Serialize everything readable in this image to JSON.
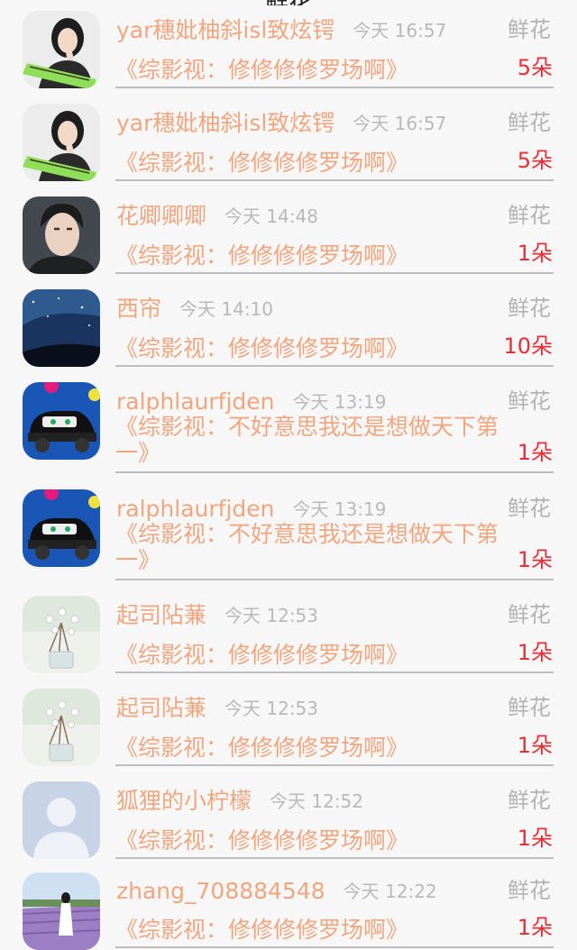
{
  "header": {
    "partial_title": "鲜花"
  },
  "items": [
    {
      "name": "yar穗妣柚斜isl致炫锷",
      "time": "今天 16:57",
      "label": "鲜花",
      "message": "《综影视：修修修修罗场啊》",
      "count": "5朵",
      "avatar": "girl-green-banner"
    },
    {
      "name": "yar穗妣柚斜isl致炫锷",
      "time": "今天 16:57",
      "label": "鲜花",
      "message": "《综影视：修修修修罗场啊》",
      "count": "5朵",
      "avatar": "girl-green-banner"
    },
    {
      "name": "花卿卿卿",
      "time": "今天 14:48",
      "label": "鲜花",
      "message": "《综影视：修修修修罗场啊》",
      "count": "1朵",
      "avatar": "man-portrait"
    },
    {
      "name": "西帘",
      "time": "今天 14:10",
      "label": "鲜花",
      "message": "《综影视：修修修修罗场啊》",
      "count": "10朵",
      "avatar": "starry-night"
    },
    {
      "name": "ralphlaurfjden",
      "time": "今天 13:19",
      "label": "鲜花",
      "message": "《综影视：不好意思我还是想做天下第一》",
      "count": "1朵",
      "avatar": "cartoon-car"
    },
    {
      "name": "ralphlaurfjden",
      "time": "今天 13:19",
      "label": "鲜花",
      "message": "《综影视：不好意思我还是想做天下第一》",
      "count": "1朵",
      "avatar": "cartoon-car"
    },
    {
      "name": "起司阽蒹",
      "time": "今天 12:53",
      "label": "鲜花",
      "message": "《综影视：修修修修罗场啊》",
      "count": "1朵",
      "avatar": "cotton-flowers"
    },
    {
      "name": "起司阽蒹",
      "time": "今天 12:53",
      "label": "鲜花",
      "message": "《综影视：修修修修罗场啊》",
      "count": "1朵",
      "avatar": "cotton-flowers"
    },
    {
      "name": "狐狸的小柠檬",
      "time": "今天 12:52",
      "label": "鲜花",
      "message": "《综影视：修修修修罗场啊》",
      "count": "1朵",
      "avatar": "default-user"
    },
    {
      "name": "zhang_708884548",
      "time": "今天 12:22",
      "label": "鲜花",
      "message": "《综影视：修修修修罗场啊》",
      "count": "1朵",
      "avatar": "lavender-field"
    }
  ]
}
